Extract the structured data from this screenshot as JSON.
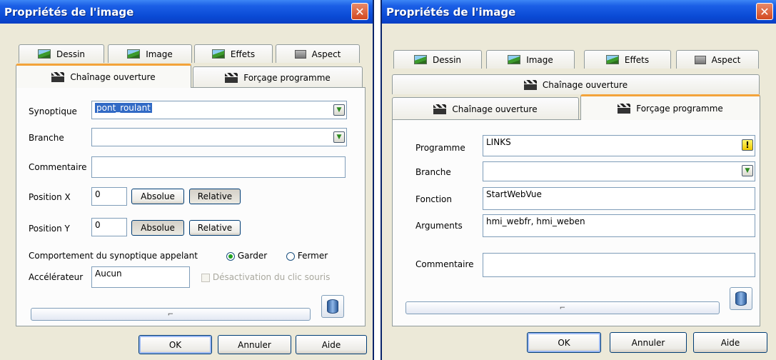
{
  "left": {
    "title": "Propriétés de l'image",
    "close": "✕",
    "tabs_row1": [
      {
        "label": "Dessin",
        "icon": "picture-icon"
      },
      {
        "label": "Image",
        "icon": "picture-icon"
      },
      {
        "label": "Effets",
        "icon": "picture-icon"
      },
      {
        "label": "Aspect",
        "icon": "aspect-icon"
      }
    ],
    "tabs_row2": [
      {
        "label": "Chaînage ouverture",
        "icon": "clapperboard-icon",
        "active": true
      },
      {
        "label": "Forçage programme",
        "icon": "clapperboard-icon"
      }
    ],
    "form": {
      "synoptique_label": "Synoptique",
      "synoptique_value": "pont_roulant",
      "branche_label": "Branche",
      "branche_value": "",
      "commentaire_label": "Commentaire",
      "commentaire_value": "",
      "posx_label": "Position X",
      "posx_value": "0",
      "posy_label": "Position Y",
      "posy_value": "0",
      "absolue": "Absolue",
      "relative": "Relative",
      "comportement_label": "Comportement du synoptique appelant",
      "garder": "Garder",
      "fermer": "Fermer",
      "accel_label": "Accélérateur",
      "accel_value": "Aucun",
      "desactivation": "Désactivation du clic souris",
      "scroll_glyph": "⌐"
    },
    "buttons": {
      "ok": "OK",
      "annuler": "Annuler",
      "aide": "Aide"
    }
  },
  "right": {
    "title": "Propriétés de l'image",
    "close": "✕",
    "tabs_row1": [
      {
        "label": "Dessin",
        "icon": "picture-icon"
      },
      {
        "label": "Image",
        "icon": "picture-icon"
      },
      {
        "label": "Effets",
        "icon": "picture-icon"
      },
      {
        "label": "Aspect",
        "icon": "aspect-icon"
      }
    ],
    "tab_middle": {
      "label": "Chaînage ouverture",
      "icon": "clapperboard-icon"
    },
    "tabs_row2": [
      {
        "label": "Chaînage ouverture",
        "icon": "clapperboard-icon"
      },
      {
        "label": "Forçage programme",
        "icon": "clapperboard-icon",
        "active": true
      }
    ],
    "form": {
      "programme_label": "Programme",
      "programme_value": "LINKS",
      "warn_glyph": "!",
      "branche_label": "Branche",
      "branche_value": "",
      "fonction_label": "Fonction",
      "fonction_value": "StartWebVue",
      "arguments_label": "Arguments",
      "arguments_value": "hmi_webfr, hmi_weben",
      "commentaire_label": "Commentaire",
      "commentaire_value": "",
      "scroll_glyph": "⌐"
    },
    "buttons": {
      "ok": "OK",
      "annuler": "Annuler",
      "aide": "Aide"
    }
  }
}
